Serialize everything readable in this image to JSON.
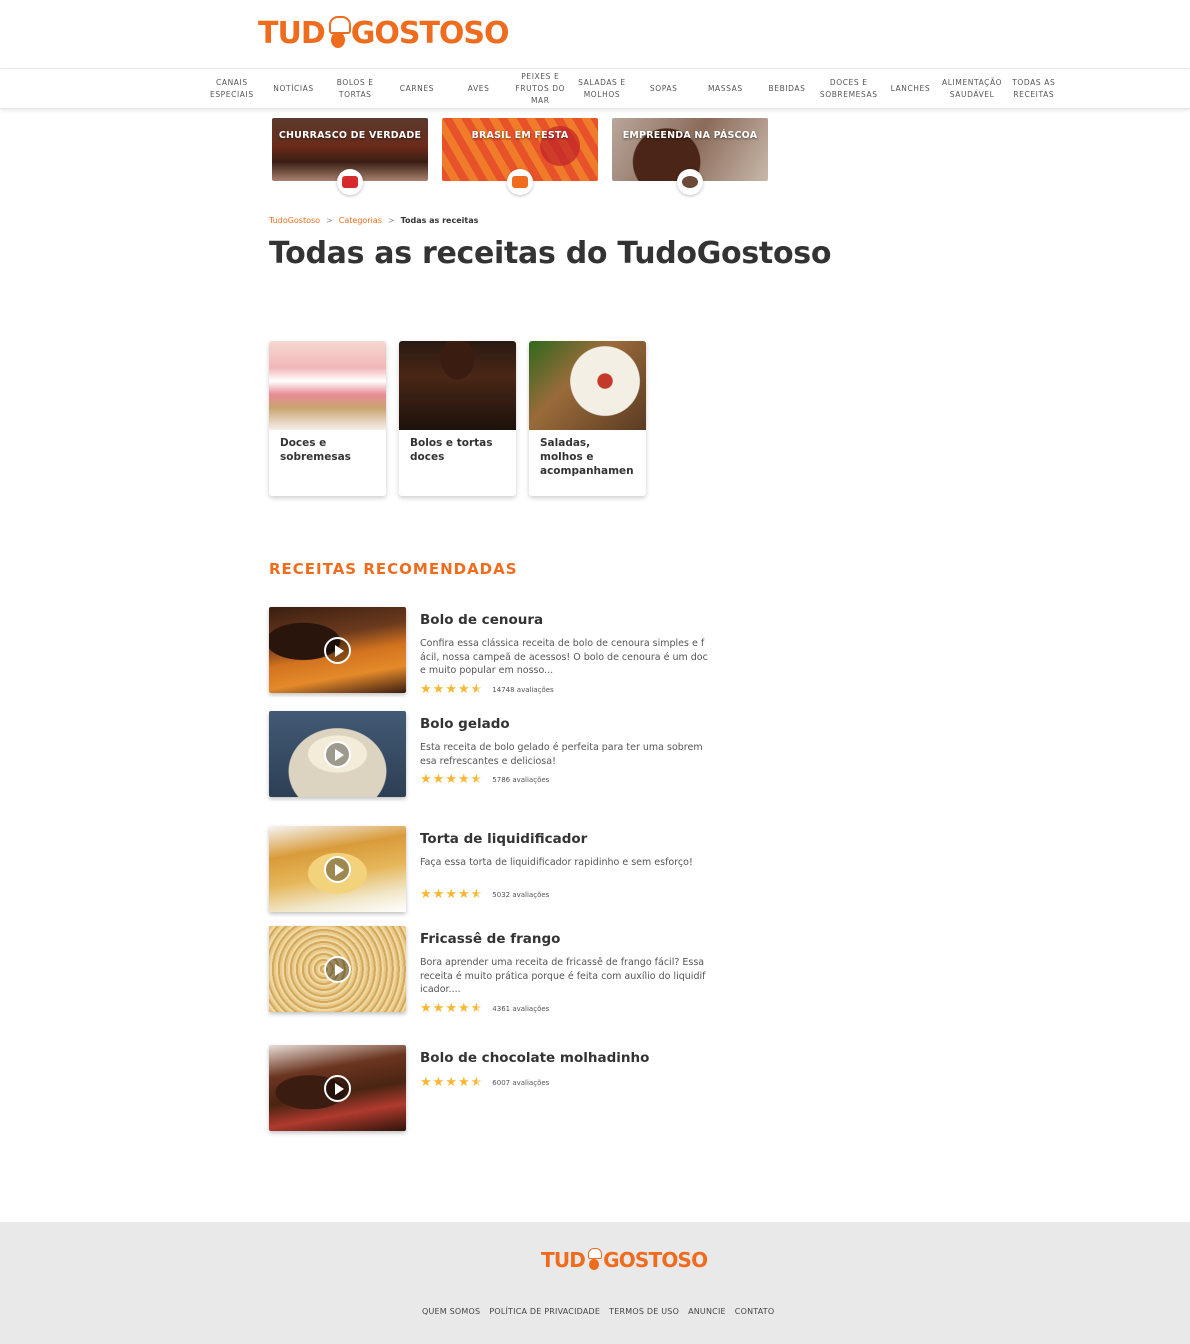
{
  "header": {
    "logo_left": "TUD",
    "logo_right": "GOSTOSO"
  },
  "nav": {
    "items": [
      {
        "line1": "CANAIS",
        "line2": "ESPECIAIS",
        "line3": ""
      },
      {
        "line1": "NOTÍCIAS",
        "line2": "",
        "line3": ""
      },
      {
        "line1": "BOLOS E",
        "line2": "TORTAS",
        "line3": ""
      },
      {
        "line1": "CARNES",
        "line2": "",
        "line3": ""
      },
      {
        "line1": "AVES",
        "line2": "",
        "line3": ""
      },
      {
        "line1": "PEIXES E",
        "line2": "FRUTOS DO",
        "line3": "MAR"
      },
      {
        "line1": "SALADAS E",
        "line2": "MOLHOS",
        "line3": ""
      },
      {
        "line1": "SOPAS",
        "line2": "",
        "line3": ""
      },
      {
        "line1": "MASSAS",
        "line2": "",
        "line3": ""
      },
      {
        "line1": "BEBIDAS",
        "line2": "",
        "line3": ""
      },
      {
        "line1": "DOCES E",
        "line2": "SOBREMESAS",
        "line3": ""
      },
      {
        "line1": "LANCHES",
        "line2": "",
        "line3": ""
      },
      {
        "line1": "ALIMENTAÇÃO",
        "line2": "SAUDÁVEL",
        "line3": ""
      },
      {
        "line1": "TODAS AS",
        "line2": "RECEITAS",
        "line3": ""
      }
    ]
  },
  "banners": [
    {
      "label": "CHURRASCO DE VERDADE",
      "badge_color": "#d62b2b"
    },
    {
      "label": "BRASIL EM FESTA",
      "badge_color": "#ef6c1e"
    },
    {
      "label": "EMPREENDA NA PÁSCOA",
      "badge_color": "#6b4a3a"
    }
  ],
  "breadcrumb": {
    "items": [
      "TudoGostoso",
      "Categorias"
    ],
    "separator": ">",
    "current": "Todas as receitas"
  },
  "page_title": "Todas as receitas do TudoGostoso",
  "categories": [
    {
      "line1": "Doces e",
      "line2": "sobremesas",
      "line3": ""
    },
    {
      "line1": "Bolos e tortas",
      "line2": "doces",
      "line3": ""
    },
    {
      "line1": "Saladas,",
      "line2": "molhos e",
      "line3": "acompanhamen"
    }
  ],
  "recommended": {
    "title": "RECEITAS RECOMENDADAS",
    "recipes": [
      {
        "title": "Bolo de cenoura",
        "desc": "Confira essa clássica receita de bolo de cenoura simples e fácil, nossa campeã de acessos! O bolo de cenoura é um doce muito popular em nosso...",
        "rating": 4.5,
        "count": "14748 avaliações"
      },
      {
        "title": "Bolo gelado",
        "desc": "Esta receita de bolo gelado é perfeita para ter uma sobremesa refrescantes e deliciosa!",
        "rating": 4.5,
        "count": "5786 avaliações"
      },
      {
        "title": "Torta de liquidificador",
        "desc": "Faça essa torta de liquidificador rapidinho e sem esforço!",
        "rating": 4.5,
        "count": "5032 avaliações"
      },
      {
        "title": "Fricassê de frango",
        "desc": "Bora aprender uma receita de fricassê de frango fácil? Essa receita é muito prática porque é feita com auxílio do liquidificador....",
        "rating": 4.5,
        "count": "4361 avaliações"
      },
      {
        "title": "Bolo de chocolate molhadinho",
        "desc": "",
        "rating": 4.5,
        "count": "6007 avaliações"
      }
    ]
  },
  "footer": {
    "logo_left": "TUD",
    "logo_right": "GOSTOSO",
    "links": [
      "QUEM SOMOS",
      "POLÍTICA DE PRIVACIDADE",
      "TERMOS DE USO",
      "ANUNCIE",
      "CONTATO"
    ]
  },
  "colors": {
    "brand": "#ef6c1e",
    "star": "#f7b733",
    "footer_bg": "#e9e9e9"
  }
}
